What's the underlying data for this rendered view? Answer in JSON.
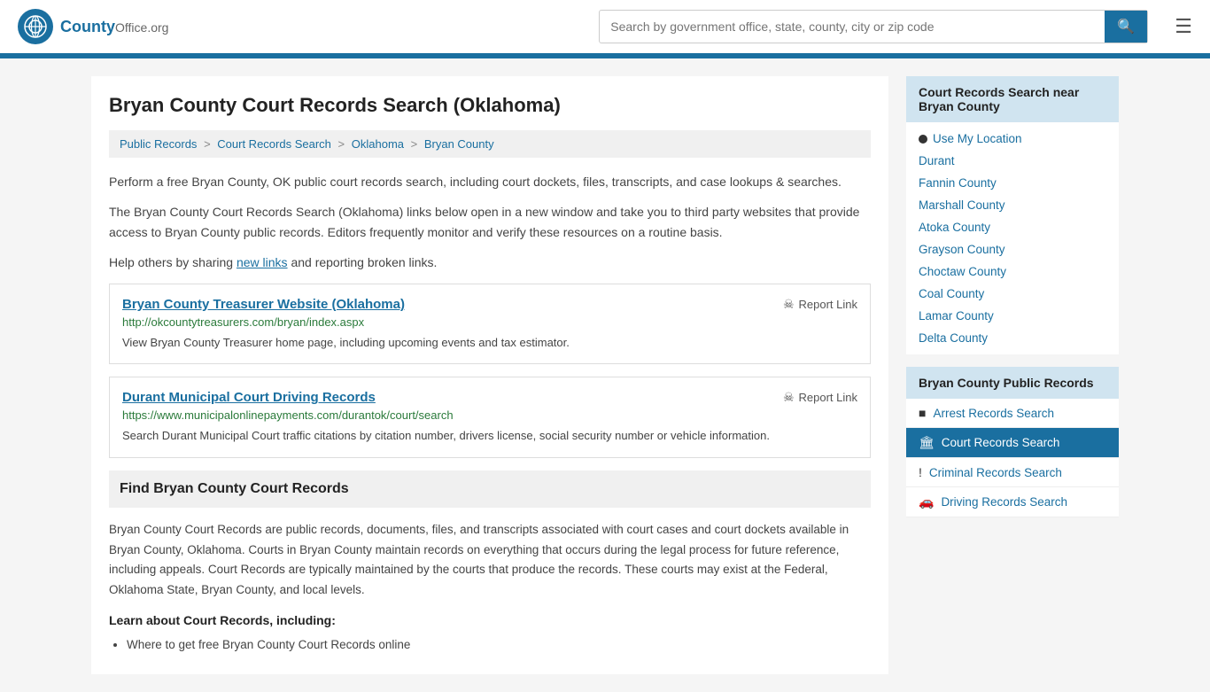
{
  "header": {
    "logo_text": "County",
    "logo_org": "Office",
    "logo_tld": ".org",
    "search_placeholder": "Search by government office, state, county, city or zip code"
  },
  "page": {
    "title": "Bryan County Court Records Search (Oklahoma)",
    "breadcrumb": [
      {
        "label": "Public Records",
        "href": "#"
      },
      {
        "label": "Court Records Search",
        "href": "#"
      },
      {
        "label": "Oklahoma",
        "href": "#"
      },
      {
        "label": "Bryan County",
        "href": "#"
      }
    ],
    "desc1": "Perform a free Bryan County, OK public court records search, including court dockets, files, transcripts, and case lookups & searches.",
    "desc2": "The Bryan County Court Records Search (Oklahoma) links below open in a new window and take you to third party websites that provide access to Bryan County public records. Editors frequently monitor and verify these resources on a routine basis.",
    "desc3_pre": "Help others by sharing ",
    "desc3_link": "new links",
    "desc3_post": " and reporting broken links."
  },
  "links": [
    {
      "title": "Bryan County Treasurer Website (Oklahoma)",
      "url": "http://okcountytreasurers.com/bryan/index.aspx",
      "description": "View Bryan County Treasurer home page, including upcoming events and tax estimator.",
      "report": "Report Link"
    },
    {
      "title": "Durant Municipal Court Driving Records",
      "url": "https://www.municipalonlinepayments.com/durantok/court/search",
      "description": "Search Durant Municipal Court traffic citations by citation number, drivers license, social security number or vehicle information.",
      "report": "Report Link"
    }
  ],
  "find_section": {
    "heading": "Find Bryan County Court Records",
    "body": "Bryan County Court Records are public records, documents, files, and transcripts associated with court cases and court dockets available in Bryan County, Oklahoma. Courts in Bryan County maintain records on everything that occurs during the legal process for future reference, including appeals. Court Records are typically maintained by the courts that produce the records. These courts may exist at the Federal, Oklahoma State, Bryan County, and local levels.",
    "learn_title": "Learn about Court Records, including:",
    "learn_items": [
      "Where to get free Bryan County Court Records online"
    ]
  },
  "sidebar": {
    "nearby_title": "Court Records Search near Bryan County",
    "use_location": "Use My Location",
    "nearby_items": [
      {
        "label": "Durant",
        "href": "#"
      },
      {
        "label": "Fannin County",
        "href": "#"
      },
      {
        "label": "Marshall County",
        "href": "#"
      },
      {
        "label": "Atoka County",
        "href": "#"
      },
      {
        "label": "Grayson County",
        "href": "#"
      },
      {
        "label": "Choctaw County",
        "href": "#"
      },
      {
        "label": "Coal County",
        "href": "#"
      },
      {
        "label": "Lamar County",
        "href": "#"
      },
      {
        "label": "Delta County",
        "href": "#"
      }
    ],
    "public_records_title": "Bryan County Public Records",
    "public_records_items": [
      {
        "label": "Arrest Records Search",
        "icon": "■",
        "active": false
      },
      {
        "label": "Court Records Search",
        "icon": "🏛",
        "active": true
      },
      {
        "label": "Criminal Records Search",
        "icon": "!",
        "active": false
      },
      {
        "label": "Driving Records Search",
        "icon": "🚗",
        "active": false
      }
    ]
  }
}
